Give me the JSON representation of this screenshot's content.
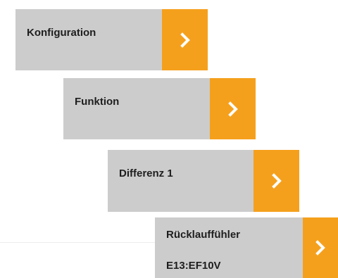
{
  "menu": {
    "items": [
      {
        "label": "Konfiguration",
        "arrow_icon": "chevron-right-icon"
      },
      {
        "label": "Funktion",
        "arrow_icon": "chevron-right-icon"
      },
      {
        "label": "Differenz 1",
        "arrow_icon": "chevron-right-icon"
      },
      {
        "label": "Rücklauffühler",
        "value": "E13:EF10V",
        "arrow_icon": "chevron-right-icon"
      }
    ]
  },
  "colors": {
    "item_background": "#cccccc",
    "accent": "#f5a01c",
    "text": "#1e1e1e",
    "arrow": "#ffffff"
  }
}
